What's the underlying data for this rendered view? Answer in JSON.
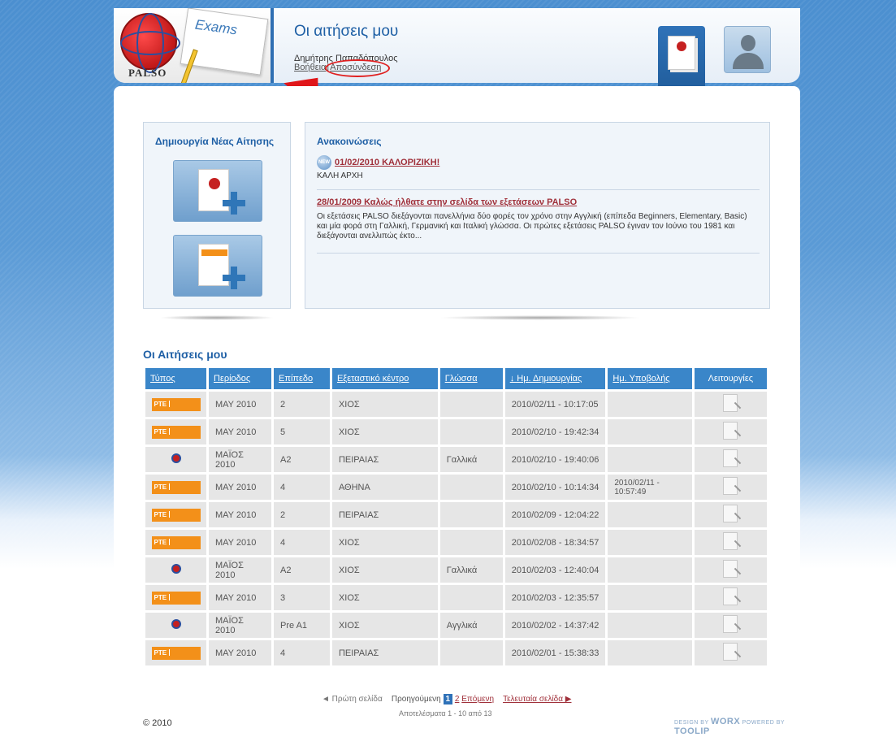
{
  "header": {
    "logo_text": "PALSO",
    "logo_exams": "Exams",
    "title": "Οι αιτήσεις μου",
    "user_name": "Δημήτρης Παπαδόπουλος",
    "help_link": "Βοήθεια",
    "separator": "|",
    "logout_link": "Αποσύνδεση",
    "annotation_step": "23",
    "annotation_color": "#e0161a"
  },
  "new_application": {
    "title": "Δημιουργία Νέας Αίτησης"
  },
  "announcements": {
    "title": "Ανακοινώσεις",
    "items": [
      {
        "badge": "NEW",
        "title": "01/02/2010 ΚΑΛΟΡΙΖΙΚΗ!",
        "body": "ΚΑΛΗ ΑΡΧΗ"
      },
      {
        "title": "28/01/2009 Καλώς ήλθατε στην σελίδα των εξετάσεων PALSO",
        "body": "Οι εξετάσεις PALSO διεξάγονται πανελλήνια δύο φορές τον χρόνο στην Αγγλική (επίπεδα Beginners, Elementary, Basic) και μία φορά στη Γαλλική, Γερμανική και Ιταλική γλώσσα. Οι πρώτες εξετάσεις PALSO έγιναν τον Ιούνιο του 1981 και διεξάγονται ανελλιπώς έκτο..."
      }
    ]
  },
  "requests": {
    "title": "Οι Αιτήσεις μου",
    "columns": [
      "Τύπος",
      "Περίοδος",
      "Επίπεδο",
      "Εξεταστικό κέντρο",
      "Γλώσσα",
      "↓ Ημ. Δημιουργίας",
      "Ημ. Υποβολής",
      "Λειτουργίες"
    ],
    "rows": [
      {
        "type": "pte",
        "period": "ΜΑΥ 2010",
        "level": "2",
        "center": "ΧΙΟΣ",
        "language": "",
        "created": "2010/02/11 - 10:17:05",
        "submitted": ""
      },
      {
        "type": "pte",
        "period": "ΜΑΥ 2010",
        "level": "5",
        "center": "ΧΙΟΣ",
        "language": "",
        "created": "2010/02/10 - 19:42:34",
        "submitted": ""
      },
      {
        "type": "palso",
        "period": "ΜΑΪΟΣ 2010",
        "level": "A2",
        "center": "ΠΕΙΡΑΙΑΣ",
        "language": "Γαλλικά",
        "created": "2010/02/10 - 19:40:06",
        "submitted": ""
      },
      {
        "type": "pte",
        "period": "ΜΑΥ 2010",
        "level": "4",
        "center": "ΑΘΗΝΑ",
        "language": "",
        "created": "2010/02/10 - 10:14:34",
        "submitted": "2010/02/11 - 10:57:49"
      },
      {
        "type": "pte",
        "period": "ΜΑΥ 2010",
        "level": "2",
        "center": "ΠΕΙΡΑΙΑΣ",
        "language": "",
        "created": "2010/02/09 - 12:04:22",
        "submitted": ""
      },
      {
        "type": "pte",
        "period": "ΜΑΥ 2010",
        "level": "4",
        "center": "ΧΙΟΣ",
        "language": "",
        "created": "2010/02/08 - 18:34:57",
        "submitted": ""
      },
      {
        "type": "palso",
        "period": "ΜΑΪΟΣ 2010",
        "level": "A2",
        "center": "ΧΙΟΣ",
        "language": "Γαλλικά",
        "created": "2010/02/03 - 12:40:04",
        "submitted": ""
      },
      {
        "type": "pte",
        "period": "ΜΑΥ 2010",
        "level": "3",
        "center": "ΧΙΟΣ",
        "language": "",
        "created": "2010/02/03 - 12:35:57",
        "submitted": ""
      },
      {
        "type": "palso",
        "period": "ΜΑΪΟΣ 2010",
        "level": "Pre A1",
        "center": "ΧΙΟΣ",
        "language": "Αγγλικά",
        "created": "2010/02/02 - 14:37:42",
        "submitted": ""
      },
      {
        "type": "pte",
        "period": "ΜΑΥ 2010",
        "level": "4",
        "center": "ΠΕΙΡΑΙΑΣ",
        "language": "",
        "created": "2010/02/01 - 15:38:33",
        "submitted": ""
      }
    ],
    "pte_label": "PTE"
  },
  "pagination": {
    "first": "◄ Πρώτη σελίδα",
    "previous": "Προηγούμενη",
    "page_current": "1",
    "page_2": "2",
    "next": "Επόμενη",
    "last": "Τελευταία σελίδα ▶",
    "results": "Αποτελέσματα 1 - 10 από 13"
  },
  "footer": {
    "copyright": "© 2010",
    "credit_design": "DESIGN BY",
    "credit_worx": "WORX",
    "credit_powered": "POWERED BY",
    "credit_toolip": "TOOLIP"
  },
  "colors": {
    "accent": "#1e5fa5",
    "table_header": "#3a86c9",
    "pte_orange": "#f39019",
    "link_red": "#a0303a"
  }
}
